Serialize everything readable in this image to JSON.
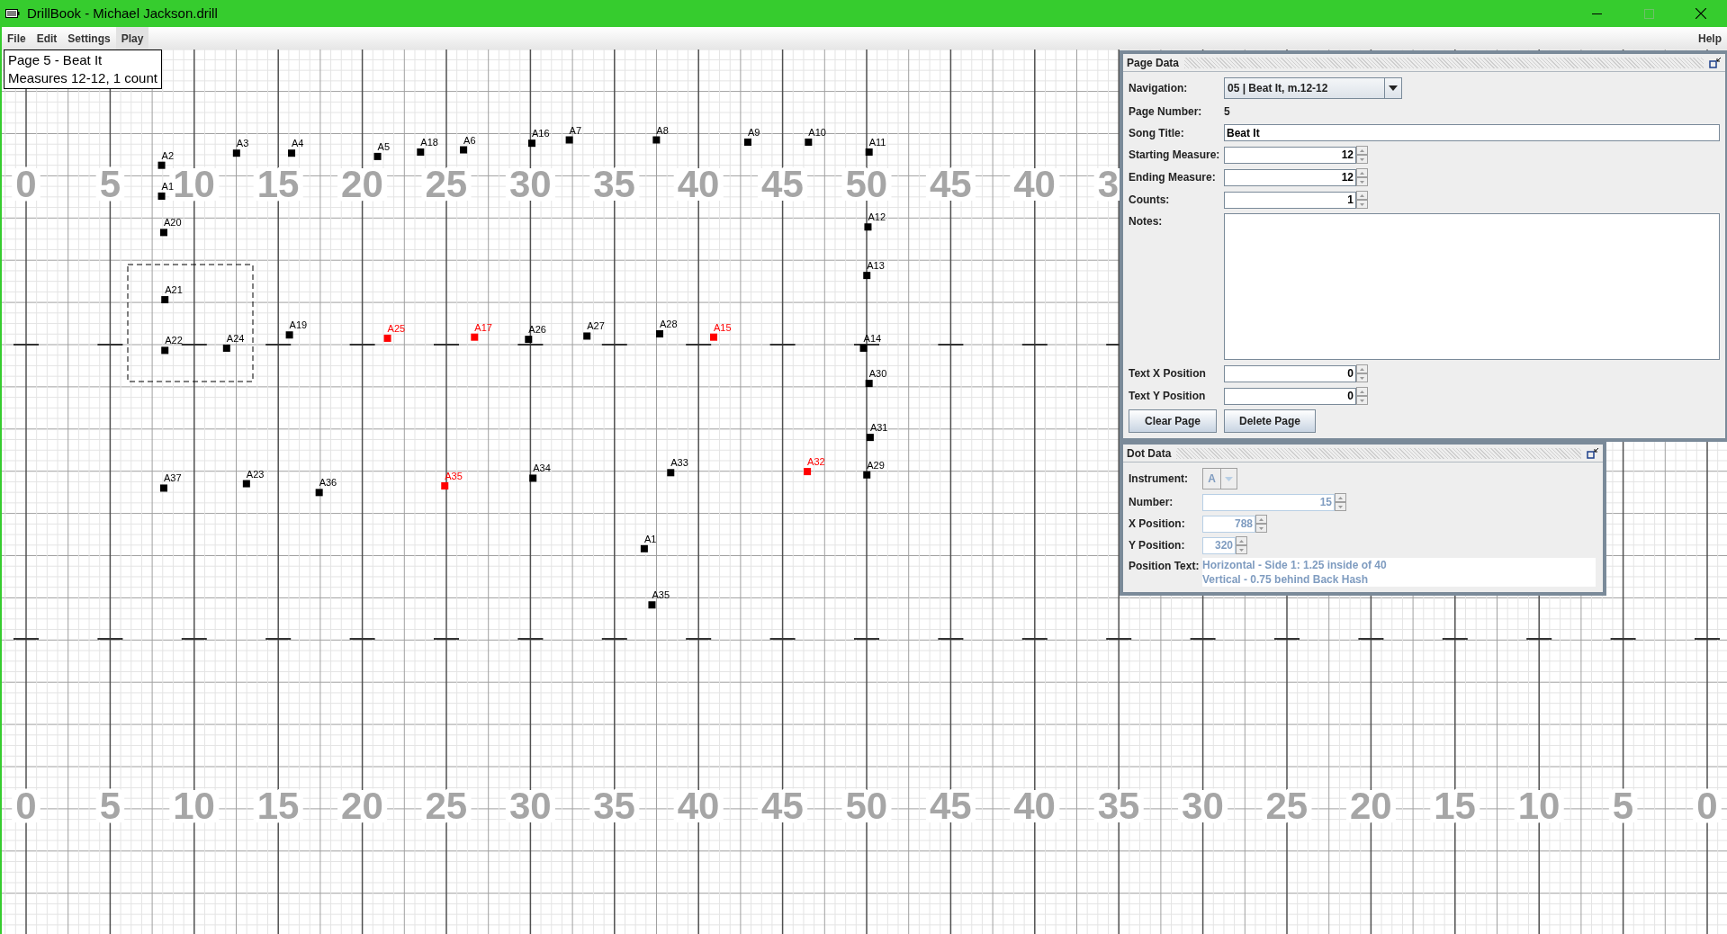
{
  "window": {
    "title": "DrillBook - Michael Jackson.drill"
  },
  "menu": [
    {
      "label": "File",
      "selected": false
    },
    {
      "label": "Edit",
      "selected": false
    },
    {
      "label": "Settings",
      "selected": false
    },
    {
      "label": "Play",
      "selected": true
    }
  ],
  "help_menu": "Help",
  "page_info": [
    "Page 5 - Beat It",
    "Measures 12-12, 1 count"
  ],
  "field": {
    "top_numbers": [
      "0",
      "5",
      "10",
      "15",
      "20",
      "25",
      "30",
      "35",
      "40",
      "45",
      "50",
      "45",
      "40",
      "3"
    ],
    "bottom_numbers": [
      "0",
      "5",
      "10",
      "15",
      "20",
      "25",
      "30",
      "35",
      "40",
      "45",
      "50",
      "45",
      "40",
      "35",
      "30",
      "25",
      "20",
      "15",
      "10",
      "5",
      "0"
    ],
    "dots": [
      {
        "label": "A2",
        "selected": false
      },
      {
        "label": "A3",
        "selected": false
      },
      {
        "label": "A4",
        "selected": false
      },
      {
        "label": "A5",
        "selected": false
      },
      {
        "label": "A18",
        "selected": false
      },
      {
        "label": "A6",
        "selected": false
      },
      {
        "label": "A16",
        "selected": false
      },
      {
        "label": "A7",
        "selected": false
      },
      {
        "label": "A8",
        "selected": false
      },
      {
        "label": "A9",
        "selected": false
      },
      {
        "label": "A10",
        "selected": false
      },
      {
        "label": "A11",
        "selected": false
      },
      {
        "label": "A1",
        "selected": false
      },
      {
        "label": "A20",
        "selected": false
      },
      {
        "label": "A12",
        "selected": false
      },
      {
        "label": "A13",
        "selected": false
      },
      {
        "label": "A21",
        "selected": false
      },
      {
        "label": "A22",
        "selected": false
      },
      {
        "label": "A24",
        "selected": false
      },
      {
        "label": "A19",
        "selected": false
      },
      {
        "label": "A25",
        "selected": true
      },
      {
        "label": "A17",
        "selected": true
      },
      {
        "label": "A26",
        "selected": false
      },
      {
        "label": "A27",
        "selected": false
      },
      {
        "label": "A28",
        "selected": false
      },
      {
        "label": "A15",
        "selected": true
      },
      {
        "label": "A14",
        "selected": false
      },
      {
        "label": "A30",
        "selected": false
      },
      {
        "label": "A31",
        "selected": false
      },
      {
        "label": "A37",
        "selected": false
      },
      {
        "label": "A23",
        "selected": false
      },
      {
        "label": "A36",
        "selected": false
      },
      {
        "label": "A35",
        "selected": true
      },
      {
        "label": "A34",
        "selected": false
      },
      {
        "label": "A33",
        "selected": false
      },
      {
        "label": "A32",
        "selected": true
      },
      {
        "label": "A29",
        "selected": false
      },
      {
        "label": "A1",
        "selected": false
      },
      {
        "label": "A35",
        "selected": false
      }
    ]
  },
  "page_data": {
    "title": "Page Data",
    "navigation": {
      "label": "Navigation:",
      "value": "05 | Beat It, m.12-12"
    },
    "page_number": {
      "label": "Page Number:",
      "value": "5"
    },
    "song_title": {
      "label": "Song Title:",
      "value": "Beat It"
    },
    "spinners": [
      {
        "label": "Starting Measure:",
        "value": "12"
      },
      {
        "label": "Ending Measure:",
        "value": "12"
      },
      {
        "label": "Counts:",
        "value": "1"
      }
    ],
    "notes": {
      "label": "Notes:"
    },
    "text_positions": [
      {
        "label": "Text X Position",
        "value": "0"
      },
      {
        "label": "Text Y Position",
        "value": "0"
      }
    ],
    "buttons": [
      "Clear Page",
      "Delete Page"
    ]
  },
  "dot_data": {
    "title": "Dot Data",
    "disabled": true,
    "instrument": {
      "label": "Instrument:",
      "value": "A"
    },
    "number": {
      "label": "Number:",
      "value": "15"
    },
    "x_position": {
      "label": "X Position:",
      "value": "788"
    },
    "y_position": {
      "label": "Y Position:",
      "value": "320"
    },
    "position_text": {
      "label": "Position Text:",
      "lines": [
        "Horizontal - Side 1: 1.25 inside of 40",
        "Vertical - 0.75 behind Back Hash"
      ]
    }
  }
}
